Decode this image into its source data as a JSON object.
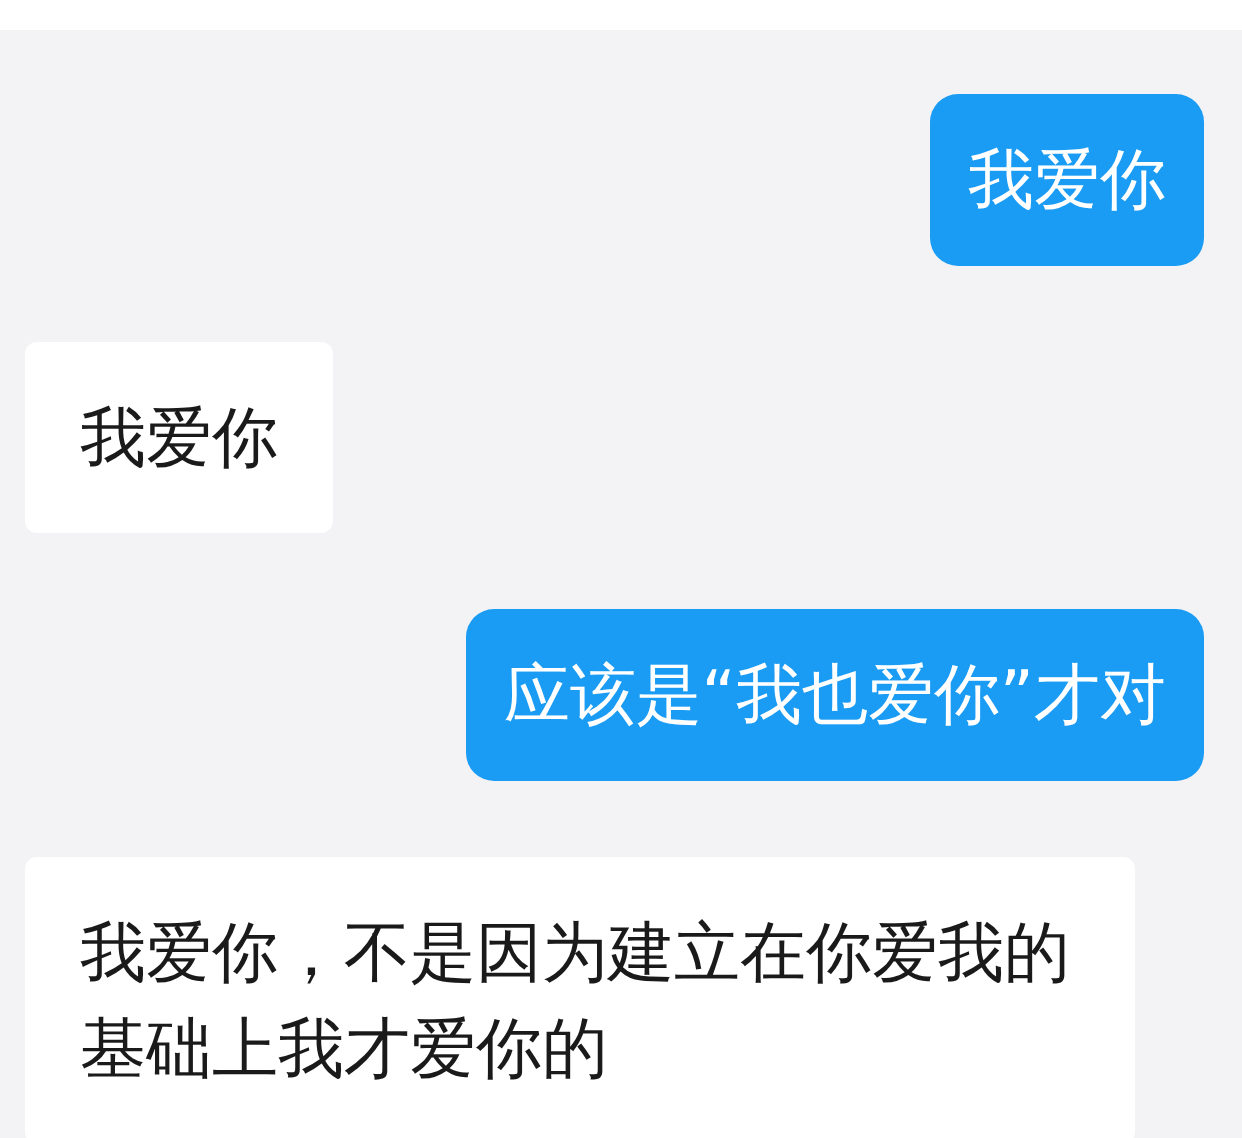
{
  "messages": [
    {
      "kind": "sent",
      "text": "我爱你"
    },
    {
      "kind": "received",
      "text": "我爱你"
    },
    {
      "kind": "sent",
      "text": "应该是“我也爱你”才对"
    },
    {
      "kind": "received",
      "text": "我爱你，不是因为建立在你爱我的基础上我才爱你的"
    }
  ]
}
